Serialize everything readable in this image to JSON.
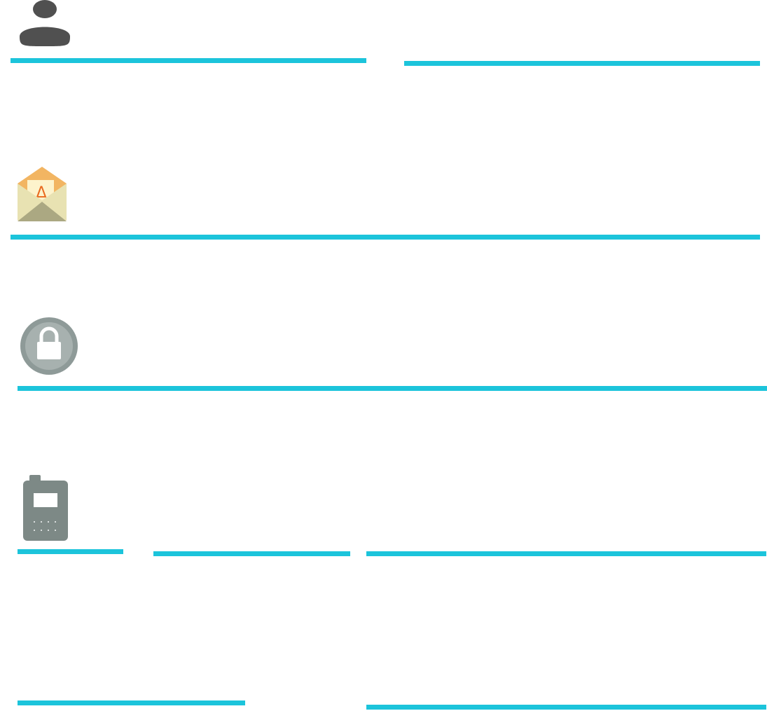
{
  "form": {
    "name_section": {
      "icon": "person-icon",
      "first_name": {
        "value": "",
        "placeholder": ""
      },
      "last_name": {
        "value": "",
        "placeholder": ""
      }
    },
    "email_section": {
      "icon": "mail-envelope-icon",
      "email": {
        "value": "",
        "placeholder": ""
      }
    },
    "password_section": {
      "icon": "lock-icon",
      "password": {
        "value": "",
        "placeholder": ""
      }
    },
    "phone_section": {
      "icon": "phone-icon",
      "country_code": {
        "value": "",
        "placeholder": ""
      },
      "area_code": {
        "value": "",
        "placeholder": ""
      },
      "phone_number": {
        "value": "",
        "placeholder": ""
      },
      "extra_left": {
        "value": "",
        "placeholder": ""
      },
      "extra_right": {
        "value": "",
        "placeholder": ""
      }
    }
  },
  "colors": {
    "underline": "#1cc4db",
    "person_icon": "#505050",
    "envelope_body": "#e8e2b2",
    "envelope_flap": "#f2b562",
    "lock_outer": "#8e9a98",
    "phone_body": "#7d8986"
  }
}
